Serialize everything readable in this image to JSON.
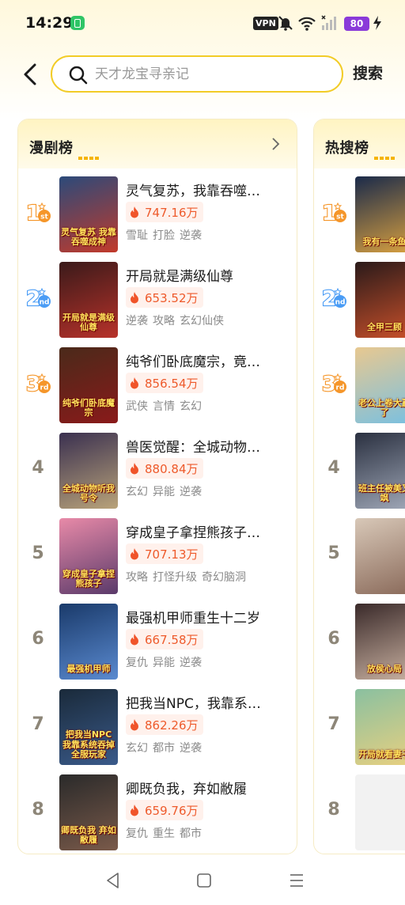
{
  "status_bar": {
    "time": "14:29",
    "vpn": "VPN",
    "battery": "80",
    "icons": [
      "app-notification-icon",
      "vpn-icon",
      "mute-bell-icon",
      "wifi-icon",
      "signal-icon",
      "battery-icon",
      "charging-icon"
    ]
  },
  "header": {
    "search_placeholder": "天才龙宝寻亲记",
    "search_button": "搜索"
  },
  "manju_list": {
    "title": "漫剧榜",
    "items": [
      {
        "rank": "1",
        "title": "灵气复苏，我靠吞噬…",
        "heat": "747.16万",
        "tags": [
          "雪耻",
          "打脸",
          "逆袭"
        ],
        "cover_text": "灵气复苏 我靠吞噬成神"
      },
      {
        "rank": "2",
        "title": "开局就是满级仙尊",
        "heat": "653.52万",
        "tags": [
          "逆袭",
          "攻略",
          "玄幻仙侠"
        ],
        "cover_text": "开局就是满级仙尊"
      },
      {
        "rank": "3",
        "title": "纯爷们卧底魔宗，竟…",
        "heat": "856.54万",
        "tags": [
          "武侠",
          "言情",
          "玄幻"
        ],
        "cover_text": "纯爷们卧底魔宗"
      },
      {
        "rank": "4",
        "title": "兽医觉醒：全城动物…",
        "heat": "880.84万",
        "tags": [
          "玄幻",
          "异能",
          "逆袭"
        ],
        "cover_text": "全城动物听我号令"
      },
      {
        "rank": "5",
        "title": "穿成皇子拿捏熊孩子…",
        "heat": "707.13万",
        "tags": [
          "攻略",
          "打怪升级",
          "奇幻脑洞"
        ],
        "cover_text": "穿成皇子拿捏熊孩子"
      },
      {
        "rank": "6",
        "title": "最强机甲师重生十二岁",
        "heat": "667.58万",
        "tags": [
          "复仇",
          "异能",
          "逆袭"
        ],
        "cover_text": "最强机甲师"
      },
      {
        "rank": "7",
        "title": "把我当NPC，我靠系…",
        "heat": "862.26万",
        "tags": [
          "玄幻",
          "都市",
          "逆袭"
        ],
        "cover_text": "把我当NPC 我靠系统吞掉全服玩家"
      },
      {
        "rank": "8",
        "title": "卿既负我，弃如敝履",
        "heat": "659.76万",
        "tags": [
          "复仇",
          "重生",
          "都市"
        ],
        "cover_text": "卿既负我 弃如敝履"
      }
    ]
  },
  "hot_search_list": {
    "title": "热搜榜",
    "items": [
      {
        "rank": "1",
        "cover_text": "我有一条鱼"
      },
      {
        "rank": "2",
        "cover_text": "全甲三顾"
      },
      {
        "rank": "3",
        "cover_text": "老公上卷大赢了"
      },
      {
        "rank": "4",
        "cover_text": "班主任被美又飒"
      },
      {
        "rank": "5",
        "cover_text": ""
      },
      {
        "rank": "6",
        "cover_text": "放侯心局"
      },
      {
        "rank": "7",
        "cover_text": "开局就看妻子"
      },
      {
        "rank": "8",
        "cover_text": ""
      }
    ]
  },
  "colors": {
    "accent_yellow": "#f2cc27",
    "heat_orange": "#ee5a2b",
    "rank_gray": "#8d8678",
    "medal_orange": "#f5962a",
    "medal_blue": "#4a9cf5"
  }
}
